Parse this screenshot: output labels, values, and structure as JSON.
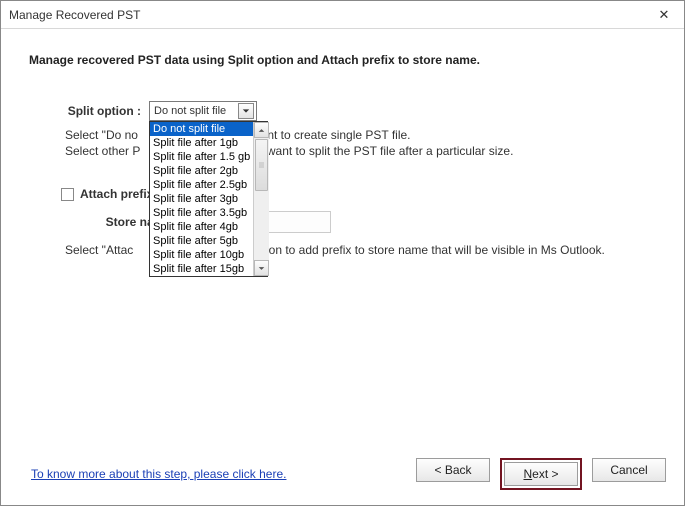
{
  "window": {
    "title": "Manage Recovered PST"
  },
  "heading": "Manage recovered PST data using Split option and Attach prefix to store name.",
  "split": {
    "label": "Split option :",
    "selected": "Do not split file",
    "options": [
      "Do not split file",
      "Split file after 1gb",
      "Split file after 1.5 gb",
      "Split file after 2gb",
      "Split file after 2.5gb",
      "Split file after 3gb",
      "Split file after 3.5gb",
      "Split file after 4gb",
      "Split file after 5gb",
      "Split file after 10gb",
      "Split file after 15gb"
    ],
    "help_line1_left": "Select \"Do no",
    "help_line1_right": "ant to create single PST file.",
    "help_line2_left": "Select other P",
    "help_line2_right": "u want to split the PST file after a particular size."
  },
  "attach": {
    "checkbox_label_left": "Attach prefix t",
    "store_label": "Store name",
    "store_value": "",
    "desc_left": "Select \"Attac",
    "desc_right": "ption to add prefix to store name that will be visible in Ms Outlook."
  },
  "footer": {
    "help_link": "To know more about this step, please click here.",
    "back": "< Back",
    "next_prefix": "N",
    "next_rest": "ext >",
    "cancel": "Cancel"
  }
}
